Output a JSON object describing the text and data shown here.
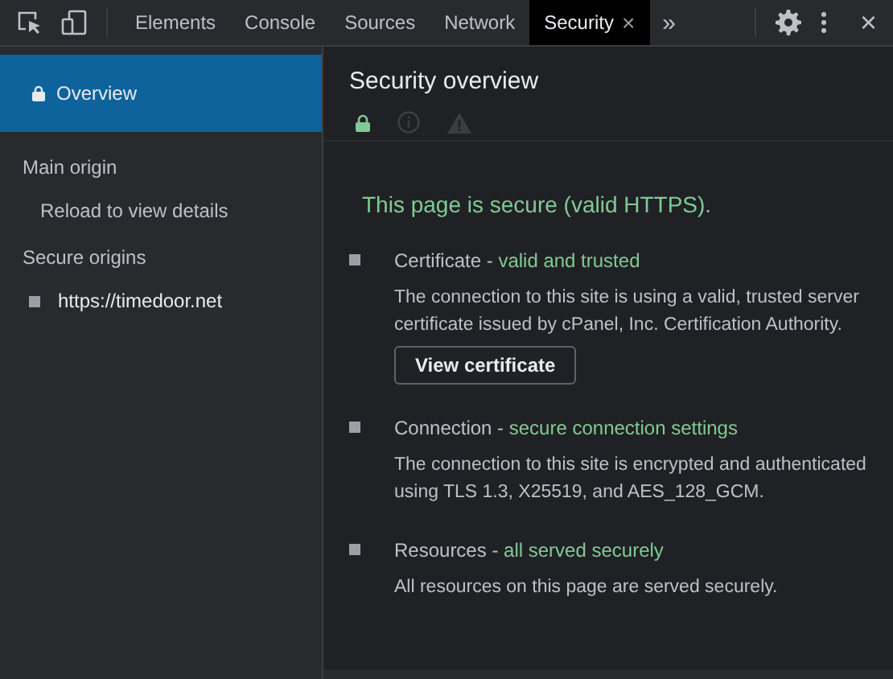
{
  "toolbar": {
    "tabs": [
      {
        "label": "Elements",
        "selected": false
      },
      {
        "label": "Console",
        "selected": false
      },
      {
        "label": "Sources",
        "selected": false
      },
      {
        "label": "Network",
        "selected": false
      },
      {
        "label": "Security",
        "selected": true,
        "close": "×"
      }
    ],
    "overflow": "»",
    "close": "×"
  },
  "sidebar": {
    "items": [
      {
        "kind": "item",
        "label": "Overview",
        "selected": true
      },
      {
        "kind": "heading",
        "label": "Main origin"
      },
      {
        "kind": "sub",
        "label": "Reload to view details"
      },
      {
        "kind": "heading",
        "label": "Secure origins"
      },
      {
        "kind": "origin",
        "label": "https://timedoor.net"
      }
    ]
  },
  "main": {
    "title": "Security overview",
    "summary_icons": [
      {
        "kind": "lock",
        "selected": true
      },
      {
        "kind": "info",
        "selected": false
      },
      {
        "kind": "warning",
        "selected": false
      }
    ],
    "summary": "This page is secure (valid HTTPS).",
    "sections": [
      {
        "title": "Certificate - ",
        "status": "valid and trusted",
        "description": "The connection to this site is using a valid, trusted server certificate issued by cPanel, Inc. Certification Authority.",
        "button": "View certificate"
      },
      {
        "title": "Connection - ",
        "status": "secure connection settings",
        "description": "The connection to this site is encrypted and authenticated using TLS 1.3, X25519, and AES_128_GCM."
      },
      {
        "title": "Resources - ",
        "status": "all served securely",
        "description": "All resources on this page are served securely."
      }
    ]
  }
}
